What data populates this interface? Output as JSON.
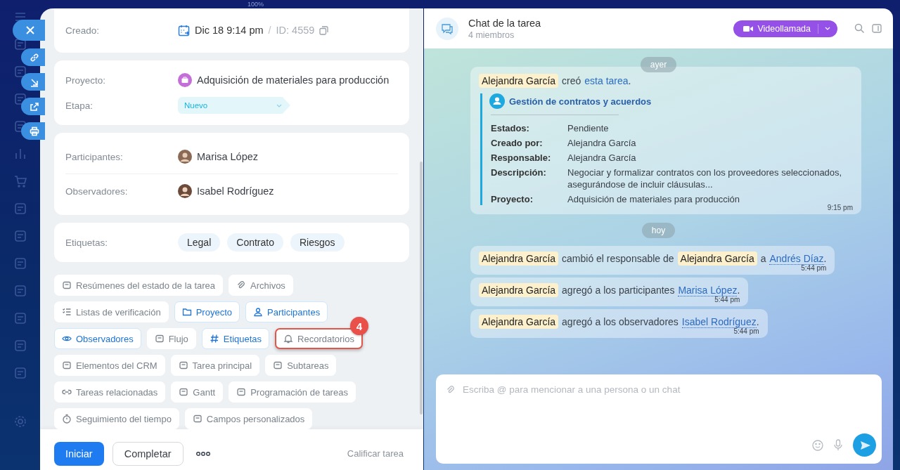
{
  "zoom_label": "100%",
  "task": {
    "created": {
      "label": "Creado:",
      "date": "Dic 18 9:14 pm",
      "separator": "/",
      "id": "ID: 4559"
    },
    "project": {
      "label": "Proyecto:",
      "value": "Adquisición de materiales para producción"
    },
    "stage": {
      "label": "Etapa:",
      "value": "Nuevo"
    },
    "participants": {
      "label": "Participantes:",
      "value": "Marisa López"
    },
    "observers": {
      "label": "Observadores:",
      "value": "Isabel Rodríguez"
    },
    "tags": {
      "label": "Etiquetas:",
      "items": [
        "Legal",
        "Contrato",
        "Riesgos"
      ]
    },
    "sections": [
      {
        "label": "Resúmenes del estado de la tarea",
        "active": false,
        "highlighted": false
      },
      {
        "label": "Archivos",
        "active": false,
        "highlighted": false
      },
      {
        "label": "Listas de verificación",
        "active": false,
        "highlighted": false
      },
      {
        "label": "Proyecto",
        "active": true,
        "highlighted": false
      },
      {
        "label": "Participantes",
        "active": true,
        "highlighted": false
      },
      {
        "label": "Observadores",
        "active": true,
        "highlighted": false
      },
      {
        "label": "Flujo",
        "active": false,
        "highlighted": false
      },
      {
        "label": "Etiquetas",
        "active": true,
        "highlighted": false
      },
      {
        "label": "Recordatorios",
        "active": false,
        "highlighted": true,
        "badge": "4"
      },
      {
        "label": "Elementos del CRM",
        "active": false,
        "highlighted": false
      },
      {
        "label": "Tarea principal",
        "active": false,
        "highlighted": false
      },
      {
        "label": "Subtareas",
        "active": false,
        "highlighted": false
      },
      {
        "label": "Tareas relacionadas",
        "active": false,
        "highlighted": false
      },
      {
        "label": "Gantt",
        "active": false,
        "highlighted": false
      },
      {
        "label": "Programación de tareas",
        "active": false,
        "highlighted": false
      },
      {
        "label": "Seguimiento del tiempo",
        "active": false,
        "highlighted": false
      },
      {
        "label": "Campos personalizados",
        "active": false,
        "highlighted": false
      }
    ]
  },
  "footer": {
    "start": "Iniciar",
    "complete": "Completar",
    "rate": "Calificar tarea"
  },
  "chat": {
    "title": "Chat de la tarea",
    "members": "4 miembros",
    "call_button": "Videollamada",
    "messages": [
      {
        "kind": "date",
        "text": "ayer"
      },
      {
        "kind": "task_created",
        "author": "Alejandra García",
        "text": "creó",
        "link": "esta tarea",
        "end": ".",
        "card": {
          "title": "Gestión de contratos y acuerdos",
          "fields": [
            {
              "label": "Estados:",
              "value": "Pendiente"
            },
            {
              "label": "Creado por:",
              "value": "Alejandra García"
            },
            {
              "label": "Responsable:",
              "value": "Alejandra García"
            },
            {
              "label": "Descripción:",
              "value": "Negociar y formalizar contratos con los proveedores seleccionados, asegurándose de incluir cláusulas..."
            },
            {
              "label": "Proyecto:",
              "value": "Adquisición de materiales para producción"
            }
          ]
        },
        "time": "9:15 pm"
      },
      {
        "kind": "date",
        "text": "hoy"
      },
      {
        "kind": "event",
        "parts": [
          {
            "kind": "mention",
            "text": "Alejandra García"
          },
          {
            "kind": "text",
            "text": "cambió el responsable de"
          },
          {
            "kind": "mention",
            "text": "Alejandra García"
          },
          {
            "kind": "text",
            "text": "a"
          },
          {
            "kind": "link",
            "text": "Andrés Díaz"
          },
          {
            "kind": "end",
            "text": "."
          }
        ],
        "time": "5:44 pm"
      },
      {
        "kind": "event",
        "parts": [
          {
            "kind": "mention",
            "text": "Alejandra García"
          },
          {
            "kind": "text",
            "text": "agregó a los participantes"
          },
          {
            "kind": "link",
            "text": "Marisa López"
          },
          {
            "kind": "end",
            "text": "."
          }
        ],
        "time": "5:44 pm"
      },
      {
        "kind": "event",
        "parts": [
          {
            "kind": "mention",
            "text": "Alejandra García"
          },
          {
            "kind": "text",
            "text": "agregó a los observadores"
          },
          {
            "kind": "link",
            "text": "Isabel Rodríguez"
          },
          {
            "kind": "end",
            "text": "."
          }
        ],
        "time": "5:44 pm"
      }
    ],
    "input": {
      "placeholder": "Escriba @ para mencionar a una persona o un chat"
    }
  }
}
